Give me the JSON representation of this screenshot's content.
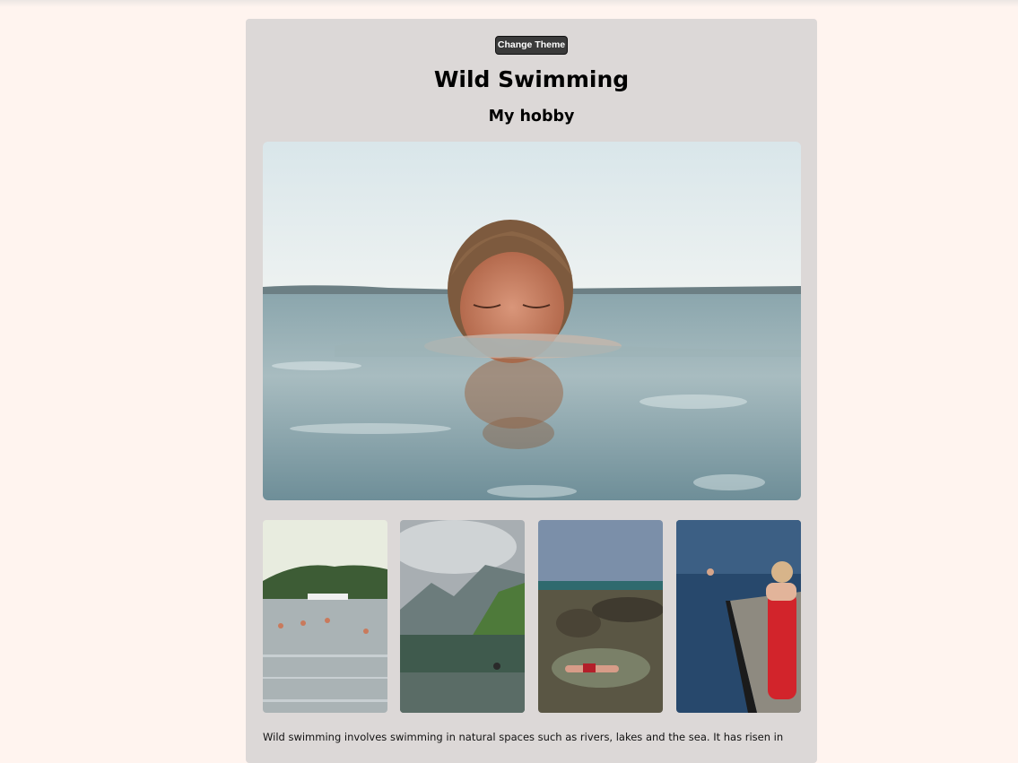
{
  "header": {
    "theme_button_label": "Change Theme",
    "title": "Wild Swimming",
    "subtitle": "My hobby"
  },
  "gallery": {
    "hero_alt": "Woman swimming with face at water level",
    "thumbnails": [
      {
        "alt": "Swimmers in a lake with boat and hills"
      },
      {
        "alt": "Person floating in mountain lake"
      },
      {
        "alt": "Person lying in a rock pool by the sea"
      },
      {
        "alt": "Woman in red towel on a pier by the sea"
      }
    ]
  },
  "intro": {
    "text": "Wild swimming involves swimming in natural spaces such as rivers, lakes and the sea. It has risen in"
  },
  "colors": {
    "page_bg": "#fff4ef",
    "card_bg": "#dcd8d7",
    "button_bg": "#3a3a3a"
  }
}
